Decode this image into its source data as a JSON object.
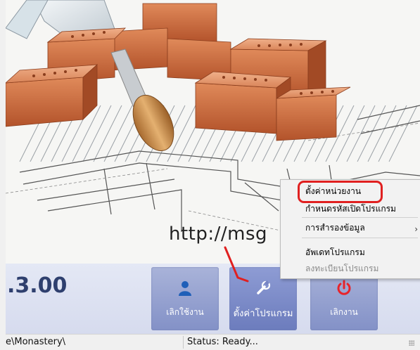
{
  "watermark": {
    "text": "http://msg"
  },
  "version": {
    "text": ".3.00"
  },
  "toolbar": {
    "logout_label": "เลิกใช้งาน",
    "settings_label": "ตั้งค่าโปรแกรม",
    "exit_label": "เลิกงาน"
  },
  "status_bar": {
    "path": "e\\Monastery\\",
    "status": "Status: Ready..."
  },
  "context_menu": {
    "items": [
      {
        "label": "ตั้งค่าหน่วยงาน"
      },
      {
        "label": "กำหนดรหัสเปิดโปรแกรม"
      },
      {
        "label": "การสำรองข้อมูล",
        "submenu_indicator": "›"
      },
      {
        "label": "อัพเดทโปรแกรม"
      },
      {
        "label": "ลงทะเบียนโปรแกรม",
        "disabled": true
      }
    ]
  },
  "colors": {
    "version_text": "#2e3f6e",
    "tile_bg": "#8391c7",
    "annotation_red": "#e02020",
    "brick": "#c8643a",
    "power_icon": "#e8242a",
    "user_icon": "#1f5fb8"
  }
}
